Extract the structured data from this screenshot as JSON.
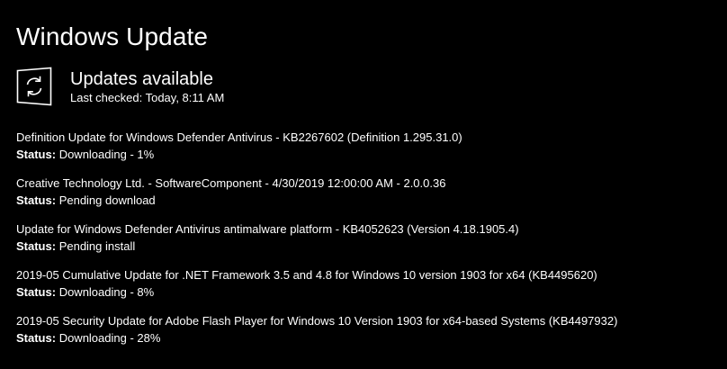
{
  "page": {
    "title": "Windows Update"
  },
  "status": {
    "icon": "refresh-icon",
    "heading": "Updates available",
    "last_checked": "Last checked: Today, 8:11 AM"
  },
  "updates": [
    {
      "name": "Definition Update for Windows Defender Antivirus - KB2267602 (Definition 1.295.31.0)",
      "status_label": "Status:",
      "status_value": "Downloading - 1%"
    },
    {
      "name": "Creative Technology Ltd. - SoftwareComponent - 4/30/2019 12:00:00 AM - 2.0.0.36",
      "status_label": "Status:",
      "status_value": "Pending download"
    },
    {
      "name": "Update for Windows Defender Antivirus antimalware platform - KB4052623 (Version 4.18.1905.4)",
      "status_label": "Status:",
      "status_value": "Pending install"
    },
    {
      "name": "2019-05 Cumulative Update for .NET Framework 3.5 and 4.8 for Windows 10 version 1903 for x64 (KB4495620)",
      "status_label": "Status:",
      "status_value": "Downloading - 8%"
    },
    {
      "name": "2019-05 Security Update for Adobe Flash Player for Windows 10 Version 1903 for x64-based Systems (KB4497932)",
      "status_label": "Status:",
      "status_value": "Downloading - 28%"
    }
  ]
}
